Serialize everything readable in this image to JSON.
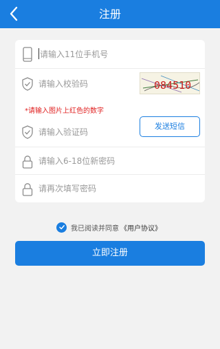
{
  "header": {
    "title": "注册",
    "back_icon": "chevron-left-icon"
  },
  "colors": {
    "primary": "#1a7ee0",
    "hint_red": "#e02222",
    "background": "#f2f2f2",
    "card": "#ffffff"
  },
  "form": {
    "phone": {
      "icon": "phone-icon",
      "placeholder": "请输入11位手机号",
      "value": ""
    },
    "captcha": {
      "icon": "shield-check-icon",
      "placeholder": "请输入校验码",
      "value": "",
      "image_text": "084510"
    },
    "captcha_hint": "*请输入图片上红色的数字",
    "sms_code": {
      "icon": "shield-check-icon",
      "placeholder": "请输入验证码",
      "value": "",
      "button_label": "发送短信"
    },
    "password": {
      "icon": "lock-icon",
      "placeholder": "请输入6-18位新密码",
      "value": ""
    },
    "password_confirm": {
      "icon": "lock-icon",
      "placeholder": "请再次填写密码",
      "value": ""
    }
  },
  "agreement": {
    "checked": true,
    "text": "我已阅读并同意",
    "link": "《用户协议》"
  },
  "submit_label": "立即注册"
}
